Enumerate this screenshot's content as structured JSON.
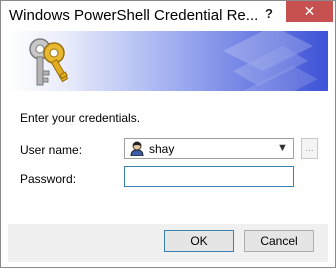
{
  "window": {
    "title": "Windows PowerShell Credential Re...",
    "help_label": "?",
    "close_label": "✕"
  },
  "banner": {
    "icons": [
      "keys-icon",
      "powershell-watermark-icon"
    ],
    "colors": {
      "start": "#ffffff",
      "end": "#3d52d6"
    }
  },
  "form": {
    "prompt": "Enter your credentials.",
    "user_label": "User name:",
    "user_value": "shay",
    "browse_label": "...",
    "password_label": "Password:",
    "password_value": ""
  },
  "buttons": {
    "ok": "OK",
    "cancel": "Cancel"
  }
}
